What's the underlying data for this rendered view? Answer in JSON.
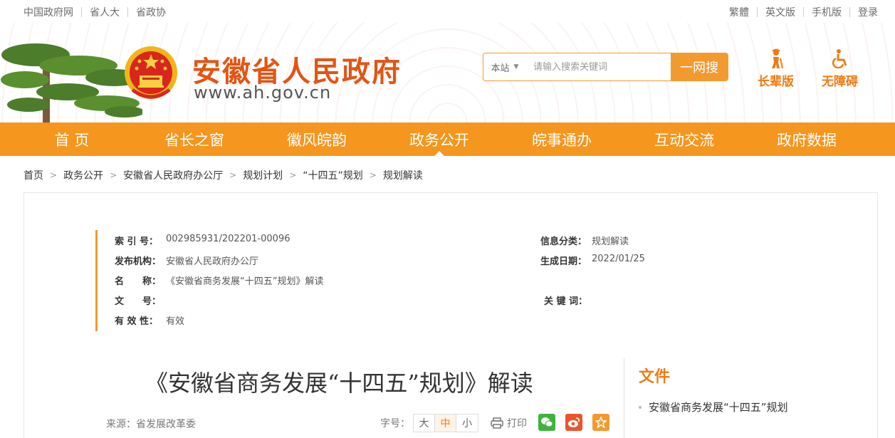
{
  "top_left_links": [
    "中国政府网",
    "省人大",
    "省政协"
  ],
  "top_right_links": [
    "繁體",
    "英文版",
    "手机版",
    "登录"
  ],
  "site": {
    "title": "安徽省人民政府",
    "url": "www.ah.gov.cn"
  },
  "search": {
    "scope": "本站",
    "placeholder": "请输入搜索关键词",
    "button": "一网搜"
  },
  "tools": {
    "elder": "长辈版",
    "accessible": "无障碍"
  },
  "nav": [
    "首 页",
    "省长之窗",
    "徽风皖韵",
    "政务公开",
    "皖事通办",
    "互动交流",
    "政府数据"
  ],
  "nav_active_index": 3,
  "breadcrumb": [
    "首页",
    "政务公开",
    "安徽省人民政府办公厅",
    "规划计划",
    "“十四五”规划",
    "规划解读"
  ],
  "meta": {
    "index_key": "索 引 号：",
    "index_val": "002985931/202201-00096",
    "category_key": "信息分类：",
    "category_val": "规划解读",
    "publisher_key": "发布机构：",
    "publisher_val": "安徽省人民政府办公厅",
    "date_key": "生成日期：",
    "date_val": "2022/01/25",
    "name_key": "名　　称：",
    "name_val": "《安徽省商务发展“十四五”规划》解读",
    "doc_key": "文　　号：",
    "doc_val": "",
    "keywords_key": "关 键 词：",
    "keywords_val": "",
    "valid_key": "有 效 性：",
    "valid_val": "有效"
  },
  "article": {
    "title": "《安徽省商务发展“十四五”规划》解读",
    "source": "来源：省发展改革委",
    "fontsize_label": "字号：",
    "fontsize_options": [
      "大",
      "中",
      "小"
    ],
    "fontsize_active": 1,
    "print": "打印"
  },
  "side": {
    "title": "文件",
    "items": [
      "安徽省商务发展“十四五”规划"
    ]
  },
  "colors": {
    "brand_orange": "#f5961e",
    "title_red": "#e25513",
    "wechat": "#3fb33b",
    "weibo": "#e9552c",
    "favorite": "#f29a2e"
  }
}
